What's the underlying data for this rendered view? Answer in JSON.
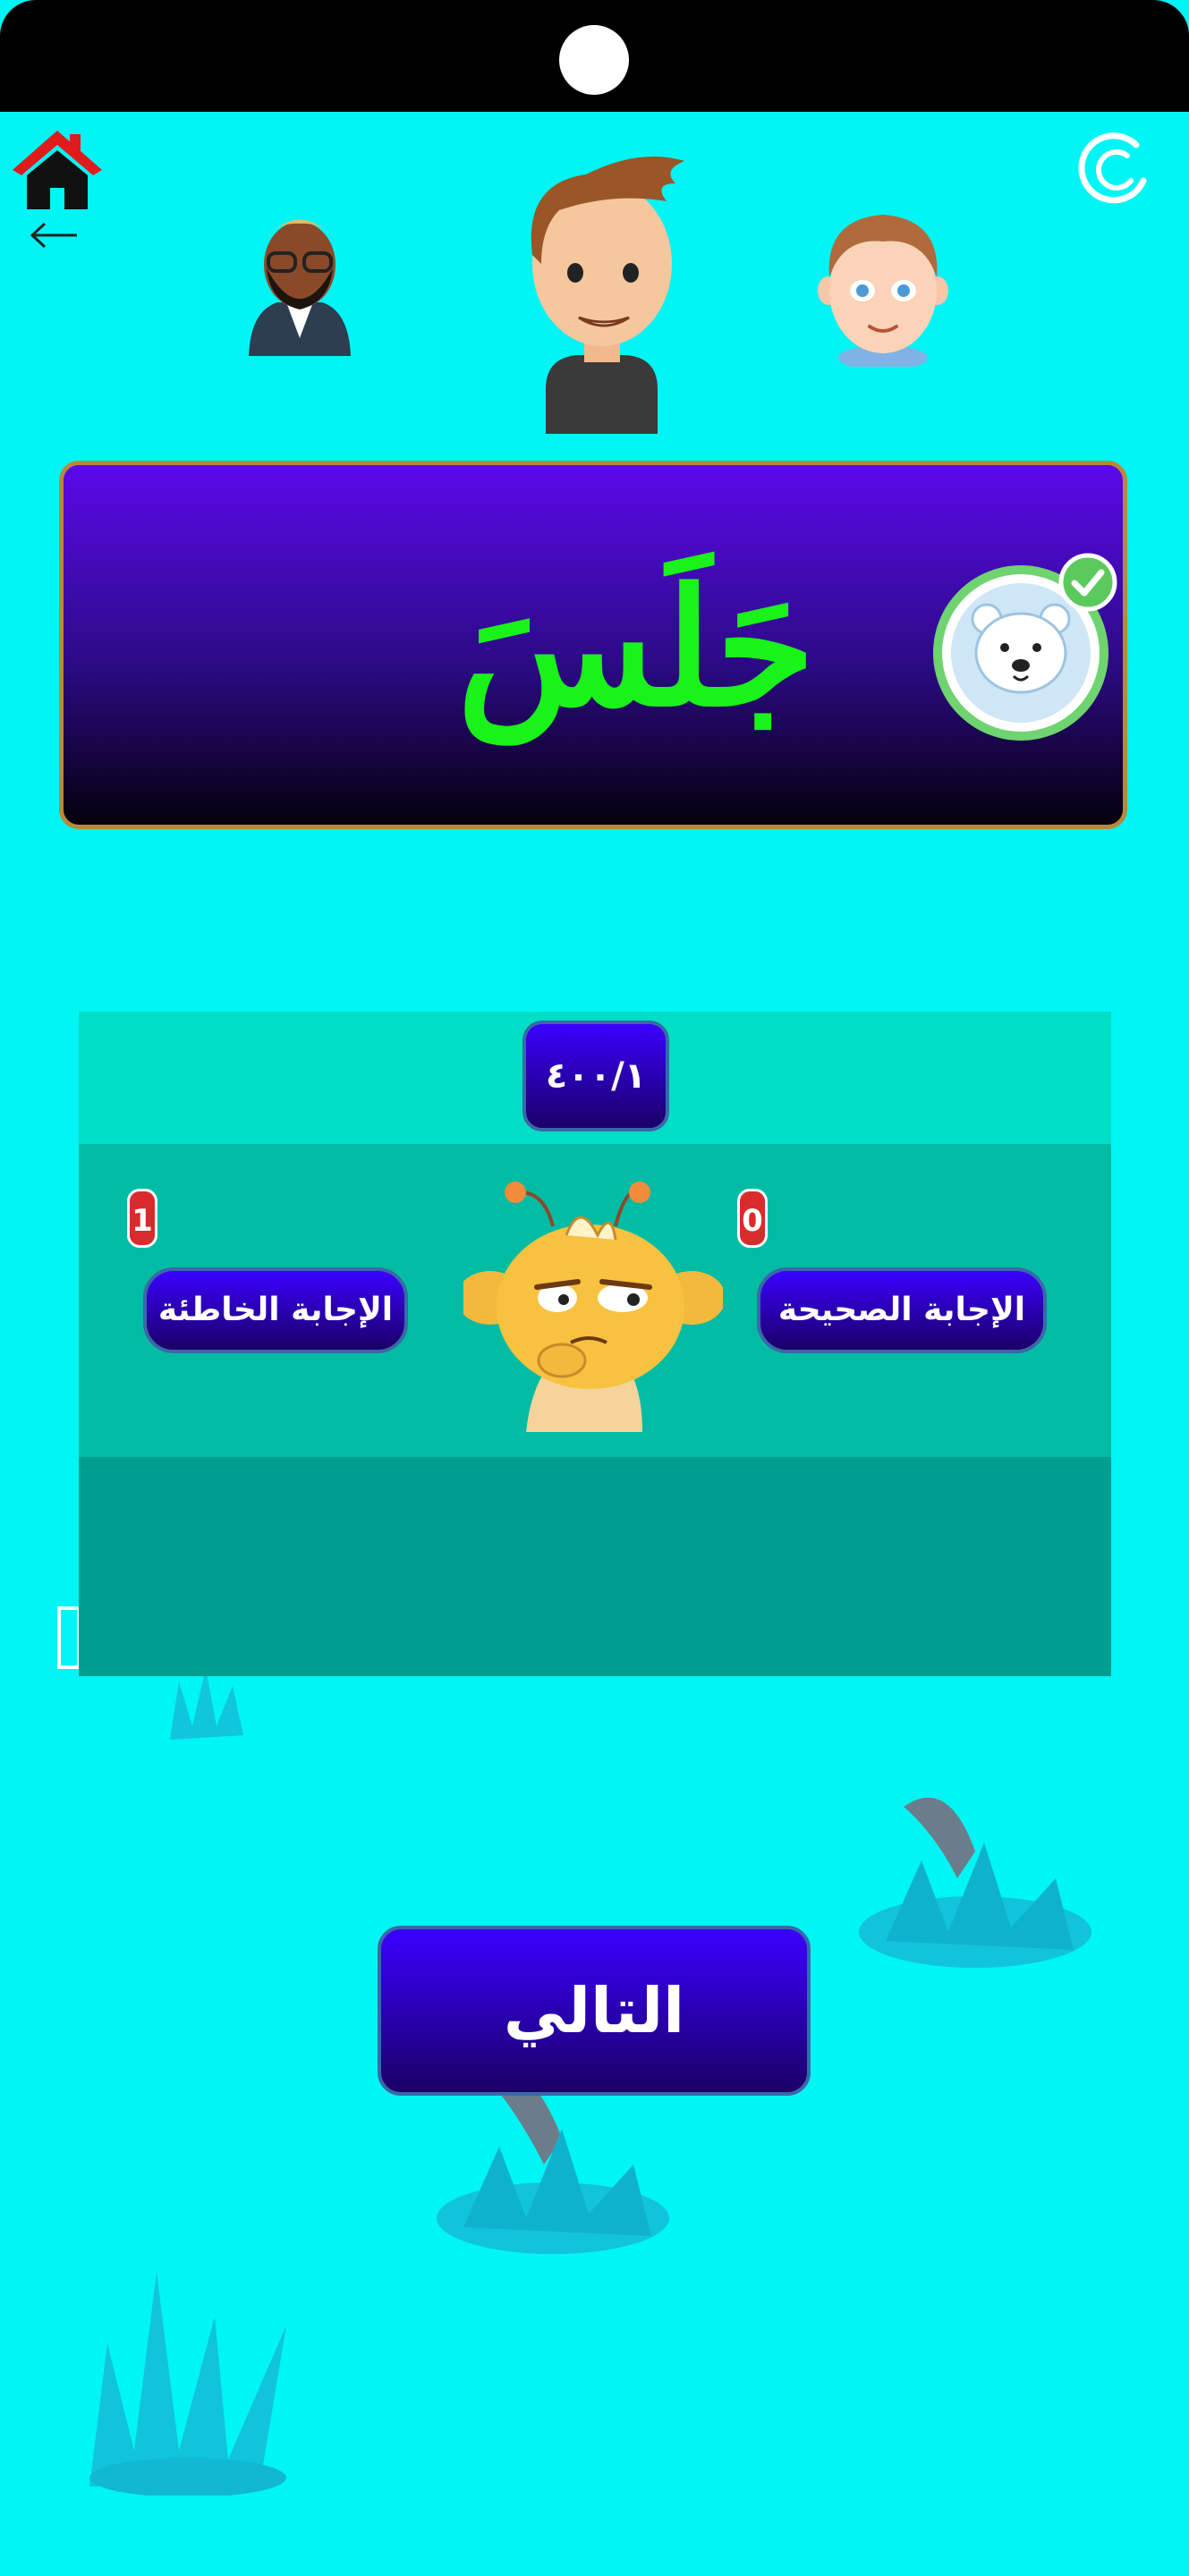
{
  "word": {
    "text": "جَلَسَ"
  },
  "progress": {
    "label": "٤٠٠/١"
  },
  "answers": {
    "correct_label": "الإجابة الصحيحة",
    "correct_count": "0",
    "wrong_label": "الإجابة الخاطئة",
    "wrong_count": "1"
  },
  "next": {
    "label": "التالي"
  },
  "colors": {
    "background": "#00f5f5",
    "word": "#19f319",
    "button": "#2a00d4",
    "card_border": "#b8893c",
    "badge": "#d92b2b"
  },
  "icons": [
    "home-icon",
    "back-arrow-icon",
    "reload-icon",
    "polar-bear-badge-icon",
    "check-icon"
  ]
}
